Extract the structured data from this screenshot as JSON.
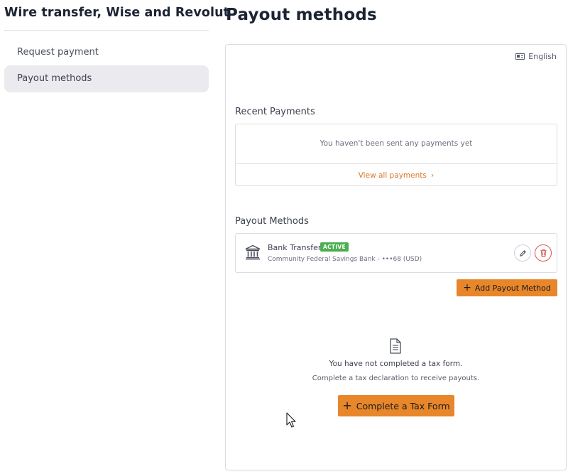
{
  "sidebar": {
    "title": "Wire transfer, Wise and Revolut",
    "items": [
      {
        "label": "Request payment",
        "active": false
      },
      {
        "label": "Payout methods",
        "active": true
      }
    ]
  },
  "main": {
    "title": "Payout methods",
    "language": {
      "label": "English",
      "icon": "language-card-icon"
    },
    "recent_payments": {
      "title": "Recent Payments",
      "empty_text": "You haven't been sent any payments yet",
      "view_all_label": "View all payments",
      "view_all_icon": "chevron-right-icon"
    },
    "payout_methods": {
      "title": "Payout Methods",
      "methods": [
        {
          "icon": "bank-icon",
          "name": "Bank Transfer",
          "status": "ACTIVE",
          "detail": "Community Federal Savings Bank - •••68 (USD)"
        }
      ],
      "add_label": "Add Payout Method"
    },
    "tax": {
      "icon": "document-icon",
      "line1": "You have not completed a tax form.",
      "line2": "Complete a tax declaration to receive payouts.",
      "button_label": "Complete a Tax Form"
    }
  },
  "colors": {
    "accent": "#e8862a",
    "link": "#d9782a",
    "badge": "#4caf50",
    "danger": "#d1584f",
    "nav_active_bg": "#ebebef"
  }
}
